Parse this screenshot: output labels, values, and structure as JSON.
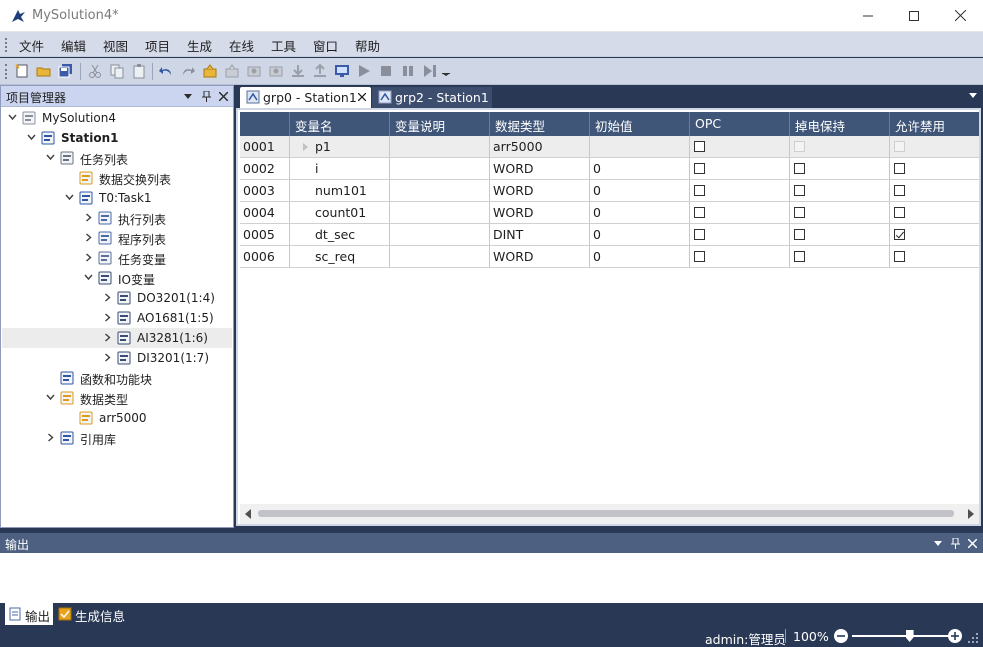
{
  "window": {
    "title": "MySolution4*"
  },
  "menu": [
    "文件",
    "编辑",
    "视图",
    "项目",
    "生成",
    "在线",
    "工具",
    "窗口",
    "帮助"
  ],
  "project_manager": {
    "title": "项目管理器",
    "tree": [
      {
        "label": "MySolution4",
        "icon": "solution-icon",
        "bold": false
      },
      {
        "label": "Station1",
        "icon": "station-icon",
        "bold": true
      },
      {
        "label": "任务列表",
        "icon": "task-list-icon",
        "bold": false
      },
      {
        "label": "数据交换列表",
        "icon": "data-exchange-icon",
        "bold": false
      },
      {
        "label": "T0:Task1",
        "icon": "task-checked-icon",
        "bold": false
      },
      {
        "label": "执行列表",
        "icon": "grid-icon",
        "bold": false
      },
      {
        "label": "程序列表",
        "icon": "program-list-icon",
        "bold": false
      },
      {
        "label": "任务变量",
        "icon": "variable-icon",
        "bold": false
      },
      {
        "label": "IO变量",
        "icon": "io-variable-icon",
        "bold": false
      },
      {
        "label": "DO3201(1:4)",
        "icon": "io-module-icon",
        "bold": false
      },
      {
        "label": "AO1681(1:5)",
        "icon": "io-module-icon",
        "bold": false
      },
      {
        "label": "AI3281(1:6)",
        "icon": "io-module-icon",
        "bold": false
      },
      {
        "label": "DI3201(1:7)",
        "icon": "io-module-icon",
        "bold": false
      },
      {
        "label": "函数和功能块",
        "icon": "function-block-icon",
        "bold": false
      },
      {
        "label": "数据类型",
        "icon": "data-type-icon",
        "bold": false
      },
      {
        "label": "arr5000",
        "icon": "data-type-item-icon",
        "bold": false
      },
      {
        "label": "引用库",
        "icon": "library-icon",
        "bold": false
      }
    ]
  },
  "tabs": [
    {
      "label": "grp0 - Station1",
      "active": true
    },
    {
      "label": "grp2 - Station1",
      "active": false
    }
  ],
  "grid": {
    "columns": [
      "变量名",
      "变量说明",
      "数据类型",
      "初始值",
      "OPC",
      "掉电保持",
      "允许禁用"
    ],
    "rows": [
      {
        "id": "0001",
        "name": "p1",
        "desc": "",
        "type": "arr5000",
        "init": "",
        "opc": false,
        "retain": false,
        "disable": false,
        "flags_enabled": false
      },
      {
        "id": "0002",
        "name": "i",
        "desc": "",
        "type": "WORD",
        "init": "0",
        "opc": false,
        "retain": false,
        "disable": false,
        "flags_enabled": true
      },
      {
        "id": "0003",
        "name": "num101",
        "desc": "",
        "type": "WORD",
        "init": "0",
        "opc": false,
        "retain": false,
        "disable": false,
        "flags_enabled": true
      },
      {
        "id": "0004",
        "name": "count01",
        "desc": "",
        "type": "WORD",
        "init": "0",
        "opc": false,
        "retain": false,
        "disable": false,
        "flags_enabled": true
      },
      {
        "id": "0005",
        "name": "dt_sec",
        "desc": "",
        "type": "DINT",
        "init": "0",
        "opc": false,
        "retain": false,
        "disable": true,
        "flags_enabled": true
      },
      {
        "id": "0006",
        "name": "sc_req",
        "desc": "",
        "type": "WORD",
        "init": "0",
        "opc": false,
        "retain": false,
        "disable": false,
        "flags_enabled": true
      }
    ]
  },
  "output": {
    "title": "输出"
  },
  "bottom_tabs": [
    "输出",
    "生成信息"
  ],
  "status": {
    "user": "admin:管理员",
    "zoom": "100%",
    "zoom_level": 0.6
  }
}
